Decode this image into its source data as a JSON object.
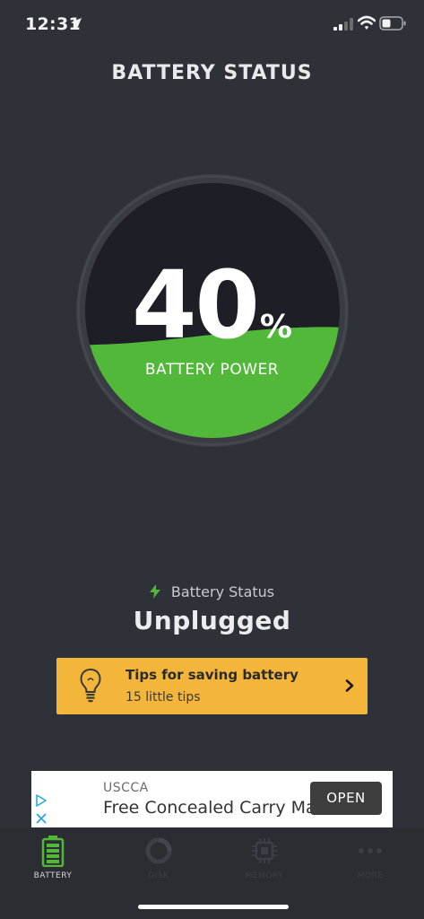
{
  "status_bar": {
    "time": "12:31"
  },
  "header": {
    "title": "BATTERY STATUS"
  },
  "gauge": {
    "percent": "40",
    "percent_symbol": "%",
    "label": "BATTERY POWER",
    "level_fraction": 0.4,
    "fill_color": "#52b83a"
  },
  "battery_status": {
    "label": "Battery Status",
    "value": "Unplugged"
  },
  "tips": {
    "title": "Tips for saving battery",
    "subtitle": "15 little tips"
  },
  "ad": {
    "brand": "USCCA",
    "headline": "Free Concealed Carry Ma",
    "cta": "OPEN"
  },
  "tabs": [
    {
      "label": "BATTERY",
      "icon": "battery-icon",
      "active": true
    },
    {
      "label": "DISK",
      "icon": "disk-icon",
      "active": false
    },
    {
      "label": "MEMORY",
      "icon": "memory-chip-icon",
      "active": false
    },
    {
      "label": "MORE",
      "icon": "more-dots-icon",
      "active": false
    }
  ],
  "colors": {
    "background": "#2f3138",
    "accent_green": "#52b83a",
    "tips_yellow": "#f3b63b"
  }
}
